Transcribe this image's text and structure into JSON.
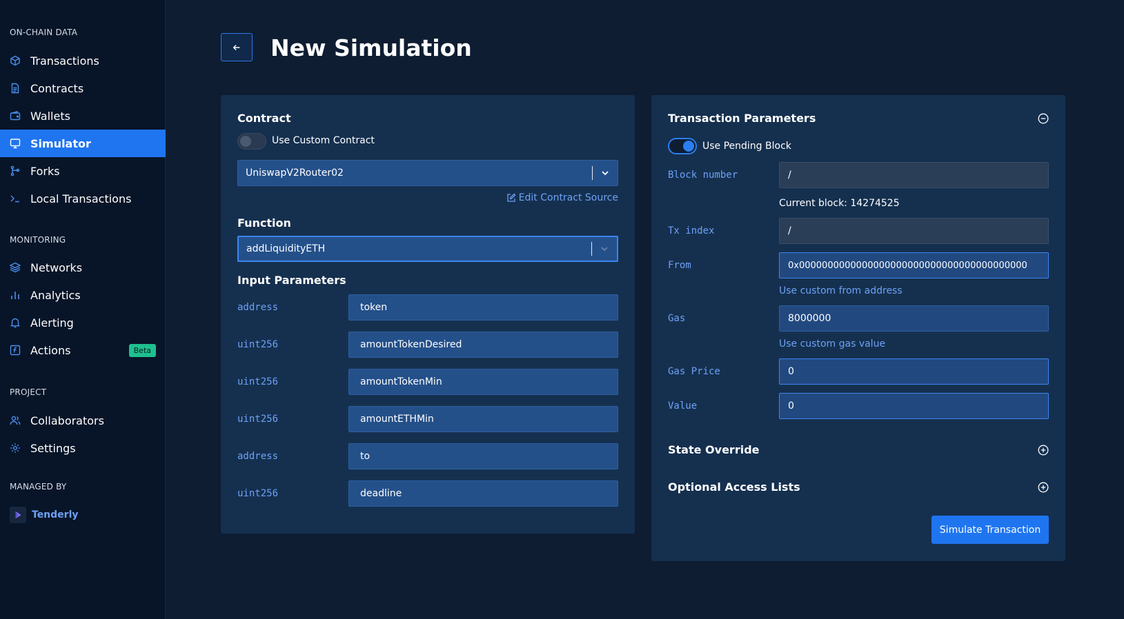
{
  "sidebar": {
    "sections": [
      {
        "title": "ON-CHAIN DATA"
      },
      {
        "title": "MONITORING"
      },
      {
        "title": "PROJECT"
      },
      {
        "title": "MANAGED BY"
      }
    ],
    "items": [
      {
        "label": "Transactions",
        "icon": "cube-icon"
      },
      {
        "label": "Contracts",
        "icon": "document-icon"
      },
      {
        "label": "Wallets",
        "icon": "wallet-icon"
      },
      {
        "label": "Simulator",
        "icon": "monitor-icon",
        "active": true
      },
      {
        "label": "Forks",
        "icon": "fork-icon"
      },
      {
        "label": "Local Transactions",
        "icon": "terminal-icon"
      },
      {
        "label": "Networks",
        "icon": "layers-icon"
      },
      {
        "label": "Analytics",
        "icon": "bar-chart-icon"
      },
      {
        "label": "Alerting",
        "icon": "bell-icon"
      },
      {
        "label": "Actions",
        "icon": "function-icon",
        "badge": "Beta"
      },
      {
        "label": "Collaborators",
        "icon": "users-icon"
      },
      {
        "label": "Settings",
        "icon": "gear-icon"
      }
    ],
    "managed_by": "Tenderly"
  },
  "header": {
    "title": "New Simulation"
  },
  "contract": {
    "heading": "Contract",
    "custom_toggle_label": "Use Custom Contract",
    "selected": "UniswapV2Router02",
    "edit_link": "Edit Contract Source"
  },
  "function": {
    "heading": "Function",
    "selected": "addLiquidityETH"
  },
  "inputs": {
    "heading": "Input Parameters",
    "params": [
      {
        "type": "address",
        "value": "token"
      },
      {
        "type": "uint256",
        "value": "amountTokenDesired"
      },
      {
        "type": "uint256",
        "value": "amountTokenMin"
      },
      {
        "type": "uint256",
        "value": "amountETHMin"
      },
      {
        "type": "address",
        "value": "to"
      },
      {
        "type": "uint256",
        "value": "deadline"
      }
    ]
  },
  "tx": {
    "heading": "Transaction Parameters",
    "pending_label": "Use Pending Block",
    "block_label": "Block number",
    "block_value": "/",
    "current_block": "Current block: 14274525",
    "tx_index_label": "Tx index",
    "tx_index_value": "/",
    "from_label": "From",
    "from_value": "0x0000000000000000000000000000000000000000",
    "from_link": "Use custom from address",
    "gas_label": "Gas",
    "gas_value": "8000000",
    "gas_link": "Use custom gas value",
    "gas_price_label": "Gas Price",
    "gas_price_value": "0",
    "value_label": "Value",
    "value_value": "0",
    "state_override": "State Override",
    "access_lists": "Optional Access Lists",
    "simulate_button": "Simulate Transaction"
  },
  "colors": {
    "accent": "#1f75f0",
    "link": "#6ea1f5",
    "badge": "#1fbf8f",
    "background": "#0e1d32",
    "sidebar": "#081528",
    "card": "#15304f"
  }
}
